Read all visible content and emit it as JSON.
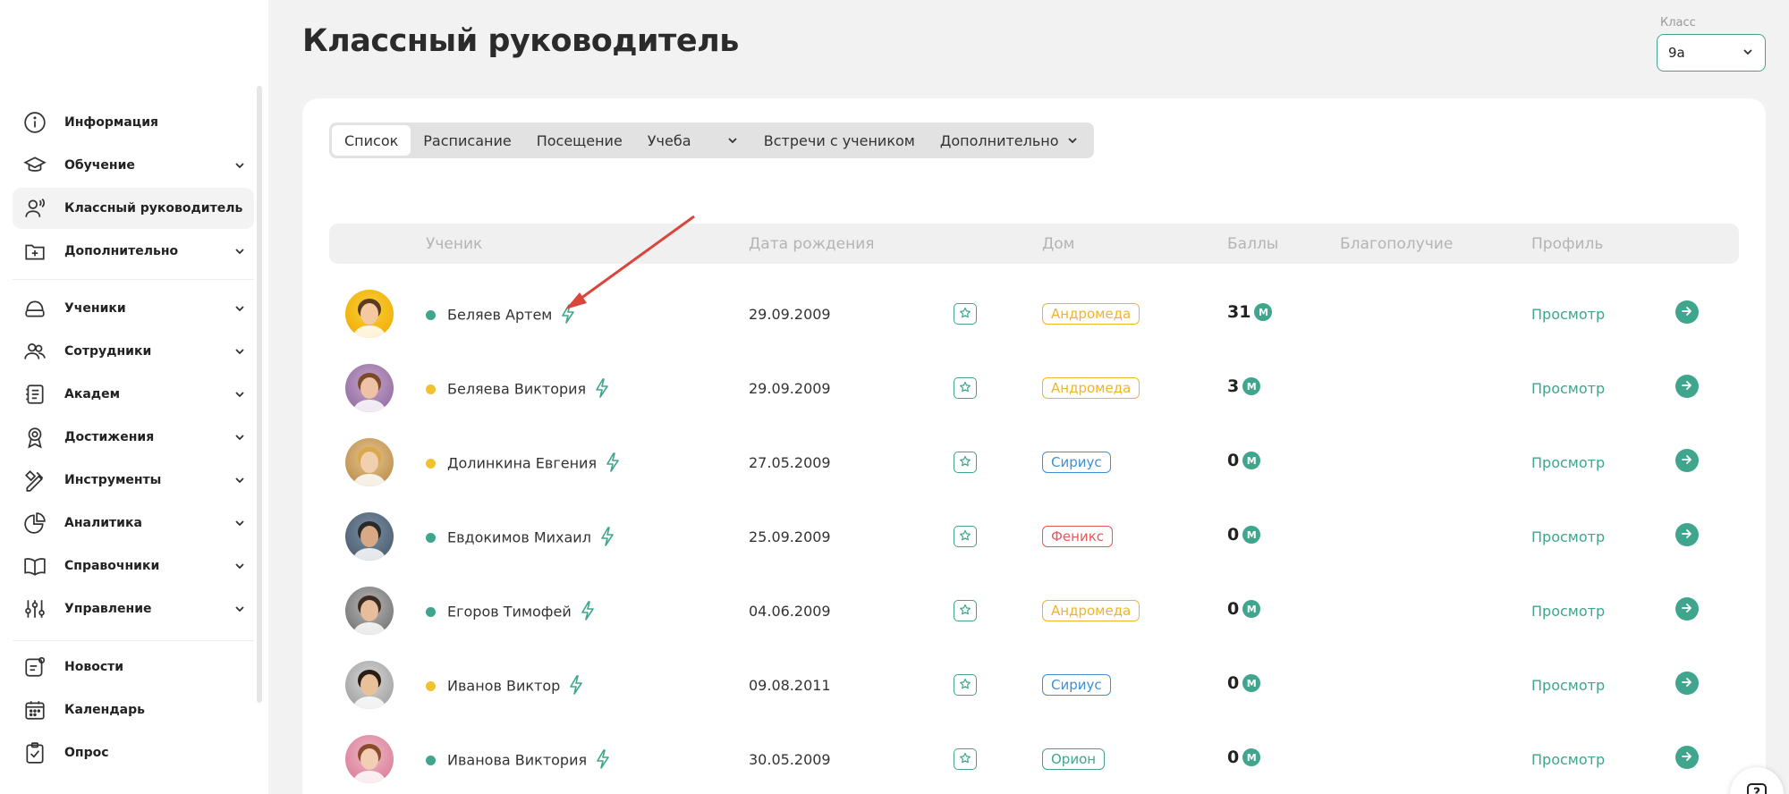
{
  "page": {
    "title": "Классный руководитель"
  },
  "class_selector": {
    "label": "Класс",
    "value": "9а"
  },
  "sidebar": {
    "items": [
      {
        "label": "Информация",
        "icon": "info-icon"
      },
      {
        "label": "Обучение",
        "icon": "graduation-cap-icon"
      },
      {
        "label": "Классный руководитель",
        "icon": "class-teacher-icon"
      },
      {
        "label": "Дополнительно",
        "icon": "add-folder-icon"
      },
      {
        "label": "Ученики",
        "icon": "students-icon"
      },
      {
        "label": "Сотрудники",
        "icon": "staff-icon"
      },
      {
        "label": "Академ",
        "icon": "academic-icon"
      },
      {
        "label": "Достижения",
        "icon": "medal-icon"
      },
      {
        "label": "Инструменты",
        "icon": "tools-icon"
      },
      {
        "label": "Аналитика",
        "icon": "pie-chart-icon"
      },
      {
        "label": "Справочники",
        "icon": "book-icon"
      },
      {
        "label": "Управление",
        "icon": "sliders-icon"
      },
      {
        "label": "Новости",
        "icon": "news-icon"
      },
      {
        "label": "Календарь",
        "icon": "calendar-icon"
      },
      {
        "label": "Опрос",
        "icon": "survey-icon"
      }
    ]
  },
  "tabs": [
    {
      "label": "Список"
    },
    {
      "label": "Расписание"
    },
    {
      "label": "Посещение"
    },
    {
      "label": "Учеба"
    },
    {
      "label": "Встречи с учеником"
    },
    {
      "label": "Дополнительно"
    }
  ],
  "table": {
    "headers": {
      "student": "Ученик",
      "dob": "Дата рождения",
      "house": "Дом",
      "points": "Баллы",
      "wellbeing": "Благополучие",
      "profile": "Профиль"
    },
    "rows": [
      {
        "name": "Беляев Артем",
        "dob": "29.09.2009",
        "house": "Андромеда",
        "points": "31",
        "status_color": "#3fa58d",
        "house_color": "#f0b429",
        "profile": "Просмотр"
      },
      {
        "name": "Беляева Виктория",
        "dob": "29.09.2009",
        "house": "Андромеда",
        "points": "3",
        "status_color": "#f2c12e",
        "house_color": "#f0b429",
        "profile": "Просмотр"
      },
      {
        "name": "Долинкина Евгения",
        "dob": "27.05.2009",
        "house": "Сириус",
        "points": "0",
        "status_color": "#f2c12e",
        "house_color": "#3d8fd6",
        "profile": "Просмотр"
      },
      {
        "name": "Евдокимов Михаил",
        "dob": "25.09.2009",
        "house": "Феникс",
        "points": "0",
        "status_color": "#3fa58d",
        "house_color": "#e5595b",
        "profile": "Просмотр"
      },
      {
        "name": "Егоров Тимофей",
        "dob": "04.06.2009",
        "house": "Андромеда",
        "points": "0",
        "status_color": "#3fa58d",
        "house_color": "#f0b429",
        "profile": "Просмотр"
      },
      {
        "name": "Иванов Виктор",
        "dob": "09.08.2011",
        "house": "Сириус",
        "points": "0",
        "status_color": "#f2c12e",
        "house_color": "#3d8fd6",
        "profile": "Просмотр"
      },
      {
        "name": "Иванова Виктория",
        "dob": "30.05.2009",
        "house": "Орион",
        "points": "0",
        "status_color": "#3fa58d",
        "house_color": "#3fa58d",
        "profile": "Просмотр"
      }
    ]
  },
  "coin_letter": "M",
  "help_label": "?",
  "colors": {
    "accent": "#3fa58d",
    "annotation_arrow": "#d9473c"
  }
}
